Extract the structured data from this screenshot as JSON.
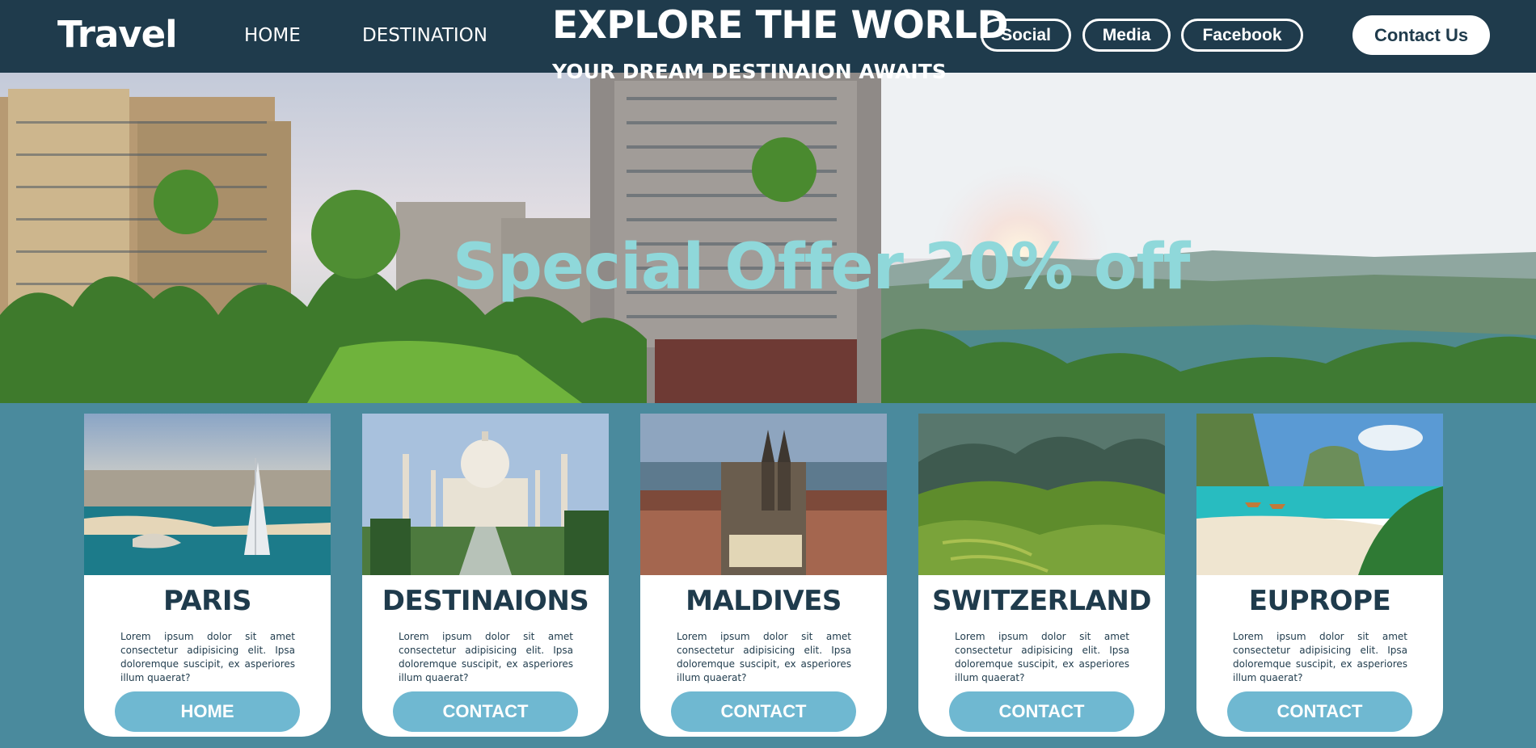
{
  "header": {
    "logo": "Travel",
    "nav": [
      {
        "label": "HOME"
      },
      {
        "label": "DESTINATION"
      }
    ],
    "title": "EXPLORE THE WORLD",
    "subtitle": "YOUR DREAM DESTINAION AWAITS",
    "social_buttons": [
      {
        "label": "Social"
      },
      {
        "label": "Media"
      },
      {
        "label": "Facebook"
      }
    ],
    "contact_label": "Contact Us"
  },
  "banner": {
    "offer_text": "Special Offer 20% off"
  },
  "cards": [
    {
      "title": "PARIS",
      "text": "Lorem ipsum dolor sit amet consectetur adipisicing elit. Ipsa doloremque suscipit, ex asperiores illum quaerat?",
      "button": "HOME"
    },
    {
      "title": "DESTINAIONS",
      "text": "Lorem ipsum dolor sit amet consectetur adipisicing elit. Ipsa doloremque suscipit, ex asperiores illum quaerat?",
      "button": "CONTACT"
    },
    {
      "title": "MALDIVES",
      "text": "Lorem ipsum dolor sit amet consectetur adipisicing elit. Ipsa doloremque suscipit, ex asperiores illum quaerat?",
      "button": "CONTACT"
    },
    {
      "title": "SWITZERLAND",
      "text": "Lorem ipsum dolor sit amet consectetur adipisicing elit. Ipsa doloremque suscipit, ex asperiores illum quaerat?",
      "button": "CONTACT"
    },
    {
      "title": "EUPROPE",
      "text": "Lorem ipsum dolor sit amet consectetur adipisicing elit. Ipsa doloremque suscipit, ex asperiores illum quaerat?",
      "button": "CONTACT"
    }
  ],
  "colors": {
    "header_bg": "#1f3b4c",
    "page_bg": "#4a8a9d",
    "accent_button": "#6fb8d1",
    "offer_text": "#8fd8da"
  }
}
